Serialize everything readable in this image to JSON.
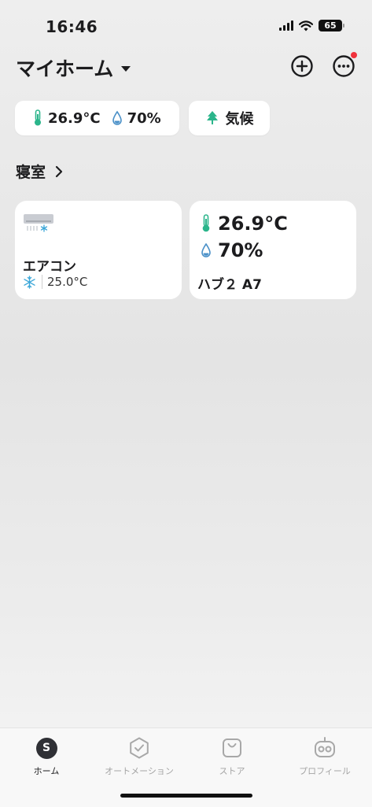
{
  "status_bar": {
    "time": "16:46",
    "battery": "65"
  },
  "header": {
    "title": "マイホーム"
  },
  "summary": {
    "temperature": "26.9°C",
    "humidity": "70%",
    "climate_label": "気候"
  },
  "room": {
    "name": "寝室"
  },
  "devices": {
    "aircon": {
      "name": "エアコン",
      "setpoint": "25.0°C"
    },
    "hub": {
      "temperature": "26.9°C",
      "humidity": "70%",
      "name": "ハブ２ A7"
    }
  },
  "tabs": [
    {
      "label": "ホーム",
      "icon": "home-s-icon",
      "active": true
    },
    {
      "label": "オートメーション",
      "icon": "check-badge-icon",
      "active": false
    },
    {
      "label": "ストア",
      "icon": "shopping-bag-icon",
      "active": false
    },
    {
      "label": "プロフィール",
      "icon": "robot-face-icon",
      "active": false
    }
  ],
  "colors": {
    "accent_green": "#2bb58b",
    "water_blue": "#4a90c8",
    "notification_red": "#f0323c",
    "snow_blue": "#3aa6d8"
  }
}
